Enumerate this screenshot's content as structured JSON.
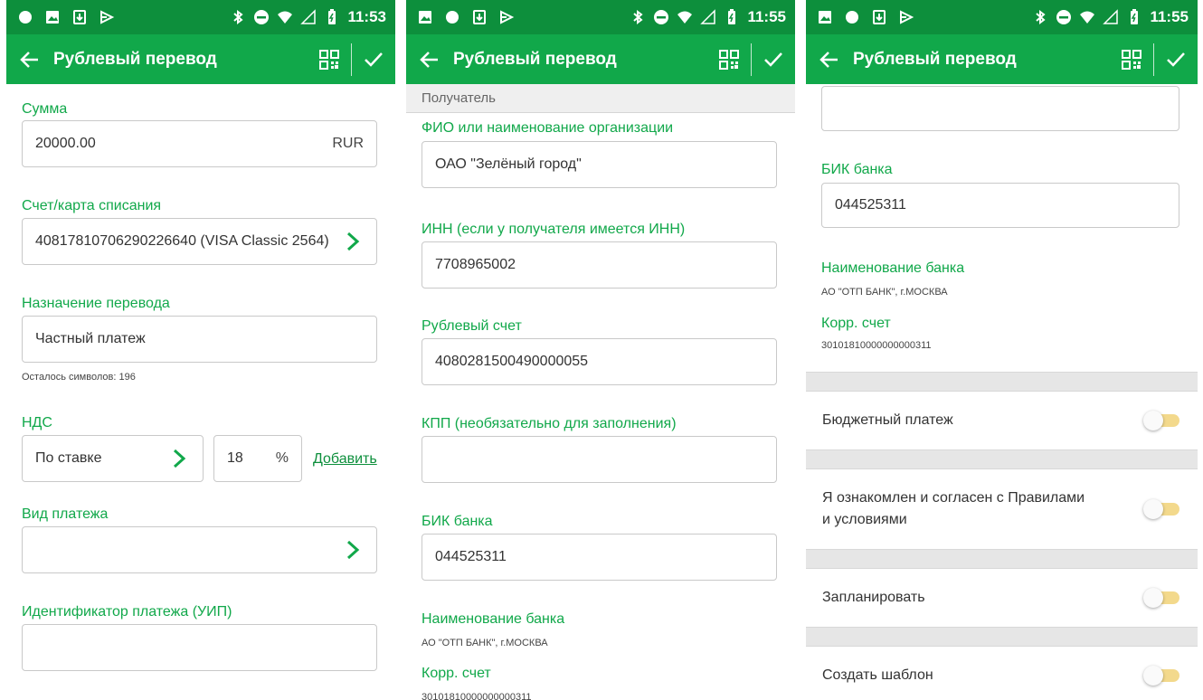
{
  "status_bar": {
    "screen1_time": "11:53",
    "screen2_time": "11:55",
    "screen3_time": "11:55"
  },
  "appbar": {
    "title": "Рублевый перевод",
    "color": "#11a84a"
  },
  "screen1": {
    "amount_label": "Сумма",
    "amount_value": "20000.00",
    "amount_currency": "RUR",
    "account_label": "Счет/карта списания",
    "account_value": "40817810706290226640 (VISA Classic 2564)",
    "purpose_label": "Назначение перевода",
    "purpose_value": "Частный платеж",
    "chars_left": "Осталось символов: 196",
    "vat_label": "НДС",
    "vat_type": "По ставке",
    "vat_rate": "18",
    "vat_percent": "%",
    "vat_add_link": "Добавить",
    "payment_type_label": "Вид платежа",
    "payment_type_value": "",
    "payment_id_label": "Идентификатор платежа (УИП)",
    "payment_id_value": ""
  },
  "screen2": {
    "section_header": "Получатель",
    "name_label": "ФИО или наименование организации",
    "name_value": "ОАО \"Зелёный город\"",
    "inn_label": "ИНН (если у получателя имеется ИНН)",
    "inn_value": "7708965002",
    "account_label": "Рублевый счет",
    "account_value": "4080281500490000055",
    "kpp_label": "КПП (необязательно для заполнения)",
    "kpp_value": "",
    "bik_label": "БИК банка",
    "bik_value": "044525311",
    "bank_name_label": "Наименование банка",
    "bank_name_value": "АО \"ОТП БАНК\", г.МОСКВА",
    "corr_label": "Корр. счет",
    "corr_value": "30101810000000000311"
  },
  "screen3": {
    "top_field_value": "",
    "bik_label": "БИК банка",
    "bik_value": "044525311",
    "bank_name_label": "Наименование банка",
    "bank_name_value": "АО \"ОТП БАНК\", г.МОСКВА",
    "corr_label": "Корр. счет",
    "corr_value": "30101810000000000311",
    "toggles": [
      {
        "label": "Бюджетный платеж",
        "on": false
      },
      {
        "label": "Я ознакомлен и согласен с Правилами",
        "label2": "и условиями",
        "on": false
      },
      {
        "label": "Запланировать",
        "on": false
      },
      {
        "label": "Создать шаблон",
        "on": false
      }
    ]
  }
}
